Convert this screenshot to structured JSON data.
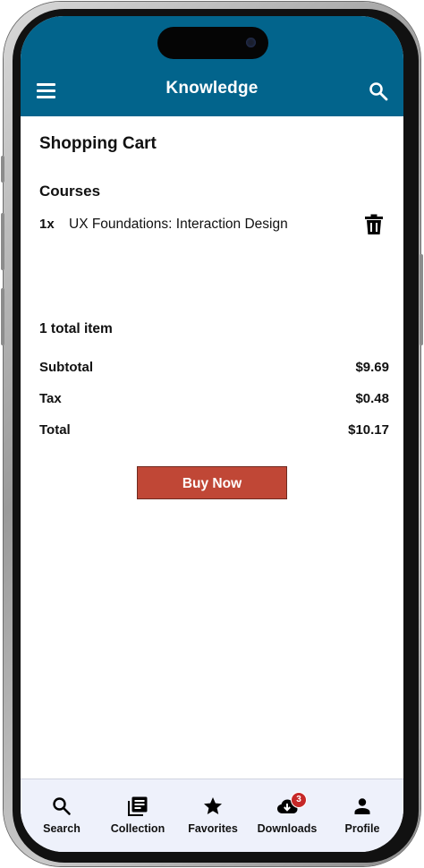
{
  "app": {
    "title": "Knowledge"
  },
  "colors": {
    "appbar": "#02648c",
    "buy_button": "#c04736",
    "badge": "#c62828",
    "nav_background": "#eef1fb"
  },
  "icons": {
    "menu": "menu-icon",
    "search": "search-icon",
    "delete": "trash-icon"
  },
  "cart": {
    "title": "Shopping Cart",
    "section": "Courses",
    "items": [
      {
        "qty": "1x",
        "name": "UX Foundations: Interaction Design"
      }
    ],
    "total_items": "1 total item",
    "summary": [
      {
        "label": "Subtotal",
        "value": "$9.69"
      },
      {
        "label": "Tax",
        "value": "$0.48"
      },
      {
        "label": "Total",
        "value": "$10.17"
      }
    ],
    "buy_label": "Buy Now"
  },
  "nav": {
    "items": [
      {
        "label": "Search",
        "icon": "search-icon"
      },
      {
        "label": "Collection",
        "icon": "collection-icon"
      },
      {
        "label": "Favorites",
        "icon": "star-icon"
      },
      {
        "label": "Downloads",
        "icon": "cloud-download-icon",
        "badge": "3"
      },
      {
        "label": "Profile",
        "icon": "person-icon"
      }
    ]
  }
}
